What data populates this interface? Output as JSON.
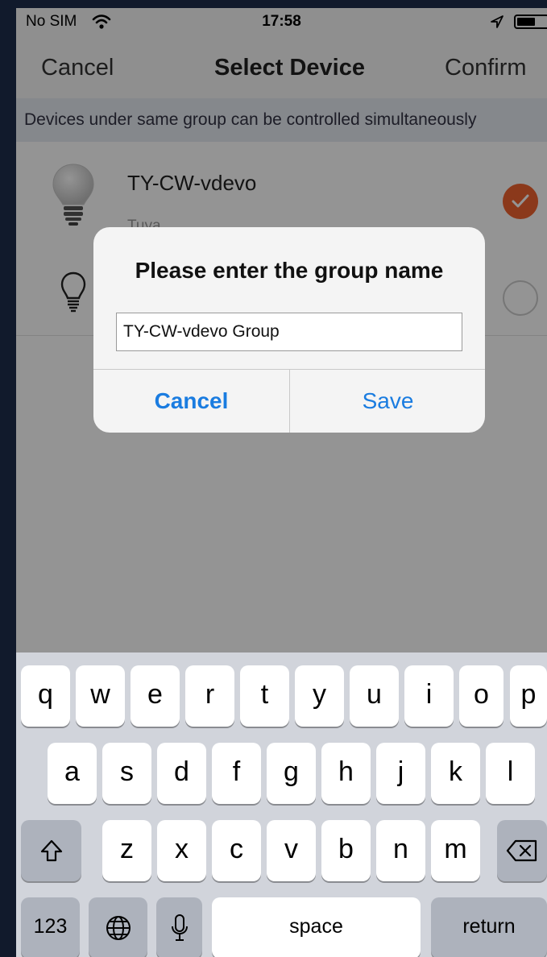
{
  "status_bar": {
    "carrier": "No SIM",
    "time": "17:58"
  },
  "nav": {
    "cancel_label": "Cancel",
    "title": "Select Device",
    "confirm_label": "Confirm"
  },
  "hint": "Devices under same group can be controlled simultaneously",
  "devices": [
    {
      "name": "TY-CW-vdevo",
      "brand": "Tuya",
      "icon": "light-bulb-icon",
      "selected": true
    },
    {
      "name": "",
      "brand": "",
      "icon": "light-bulb-outline-icon",
      "selected": false
    }
  ],
  "dialog": {
    "title": "Please enter the group name",
    "input_value": "TY-CW-vdevo Group",
    "cancel_label": "Cancel",
    "save_label": "Save"
  },
  "keyboard": {
    "row1": [
      "q",
      "w",
      "e",
      "r",
      "t",
      "y",
      "u",
      "i",
      "o",
      "p"
    ],
    "row2": [
      "a",
      "s",
      "d",
      "f",
      "g",
      "h",
      "j",
      "k",
      "l"
    ],
    "row3": [
      "z",
      "x",
      "c",
      "v",
      "b",
      "n",
      "m"
    ],
    "numbers_label": "123",
    "space_label": "space",
    "return_label": "return"
  },
  "colors": {
    "accent": "#f0632f",
    "link": "#1a7ce0"
  }
}
